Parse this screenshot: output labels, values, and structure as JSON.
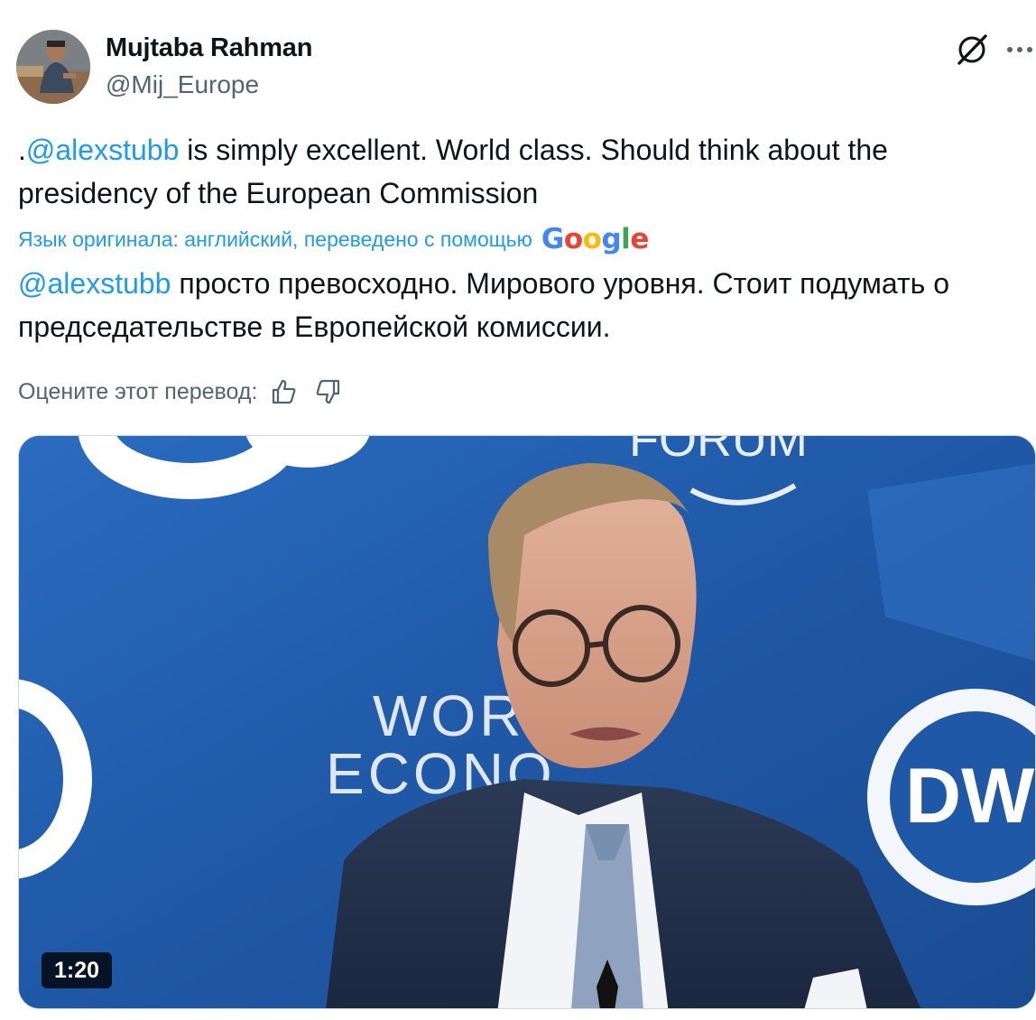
{
  "author": {
    "name": "Mujtaba Rahman",
    "handle": "@Mij_Europe"
  },
  "tweet": {
    "lead": ".",
    "mention": "@alexstubb",
    "text": " is simply excellent. World class. Should think about the presidency of the European Commission"
  },
  "translation": {
    "note": "Язык оригинала: английский, переведено с помощью",
    "provider_logo": "Google",
    "mention": "@alexstubb",
    "text": " просто превосходно. Мирового уровня. Стоит подумать о председательстве в Европейской комиссии."
  },
  "rating": {
    "prompt": "Оцените этот перевод:"
  },
  "media": {
    "duration": "1:20",
    "backdrop_text_forum": "FORUM",
    "backdrop_text_world": "WORLD",
    "backdrop_text_economic": "ECONO",
    "backdrop_logo": "DW"
  },
  "colors": {
    "accent": "#1d9bf0",
    "text": "#0f1419",
    "secondary": "#536471"
  },
  "icons": {
    "grok": "grok-icon",
    "more": "more-icon",
    "thumbs_up": "thumbs-up-icon",
    "thumbs_down": "thumbs-down-icon"
  }
}
